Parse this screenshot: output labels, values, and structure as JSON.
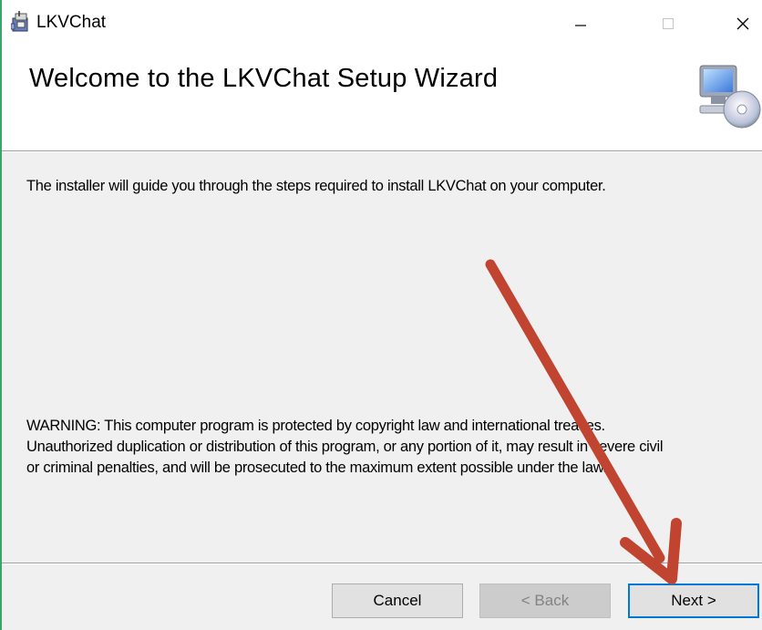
{
  "window": {
    "title": "LKVChat",
    "icons": {
      "app": "installer-package-icon",
      "minimize": "minimize-icon",
      "maximize": "maximize-icon",
      "close": "close-icon"
    }
  },
  "header": {
    "title": "Welcome to the LKVChat Setup Wizard",
    "art_icon": "computer-cd-icon"
  },
  "content": {
    "intro": "The installer will guide you through the steps required to install LKVChat on your computer.",
    "warning_lines": [
      "WARNING: This computer program is protected by copyright law and international treaties.",
      "Unauthorized duplication or distribution of this program, or any portion of it, may result in severe civil",
      "or criminal penalties, and will be prosecuted to the maximum extent possible under the law."
    ]
  },
  "buttons": {
    "cancel": "Cancel",
    "back": "< Back",
    "next": "Next >"
  },
  "annotation": {
    "color": "#c0442f",
    "icon": "red-arrow-pointing-to-next"
  }
}
